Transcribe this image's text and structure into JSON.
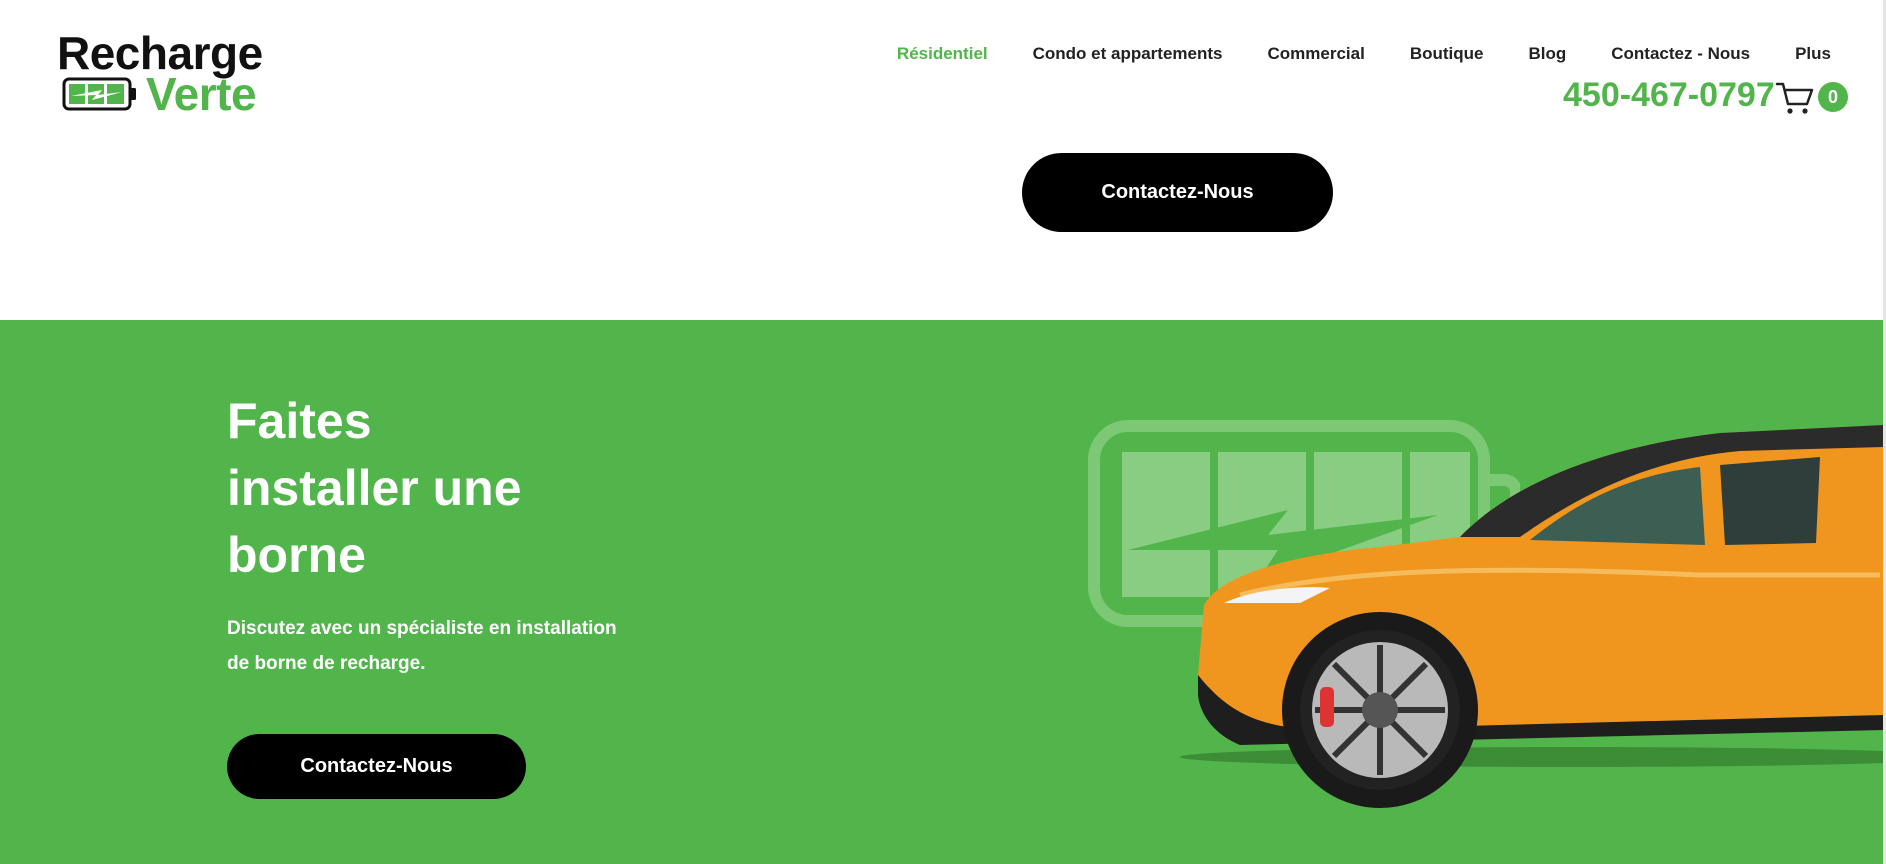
{
  "brand": {
    "line1": "Recharge",
    "line2": "Verte",
    "accent_color": "#52b54b",
    "logo_icon": "battery-logo-icon"
  },
  "nav": {
    "items": [
      {
        "label": "Résidentiel",
        "active": true
      },
      {
        "label": "Condo et appartements",
        "active": false
      },
      {
        "label": "Commercial",
        "active": false
      },
      {
        "label": "Boutique",
        "active": false
      },
      {
        "label": "Blog",
        "active": false
      },
      {
        "label": "Contactez - Nous",
        "active": false
      },
      {
        "label": "Plus",
        "active": false
      }
    ]
  },
  "header": {
    "phone": "450-467-0797",
    "cart_icon": "cart-icon",
    "cart_count": "0"
  },
  "top_section": {
    "cta_label": "Contactez-Nous"
  },
  "hero": {
    "title_lines": [
      "Faites",
      "installer une",
      "borne"
    ],
    "subtitle": "Discutez avec un spécialiste en installation de borne de recharge.",
    "cta_label": "Contactez-Nous",
    "background_color": "#52b54b",
    "image_icon": "orange-electric-suv-image",
    "decor_icon": "battery-watermark-icon"
  }
}
